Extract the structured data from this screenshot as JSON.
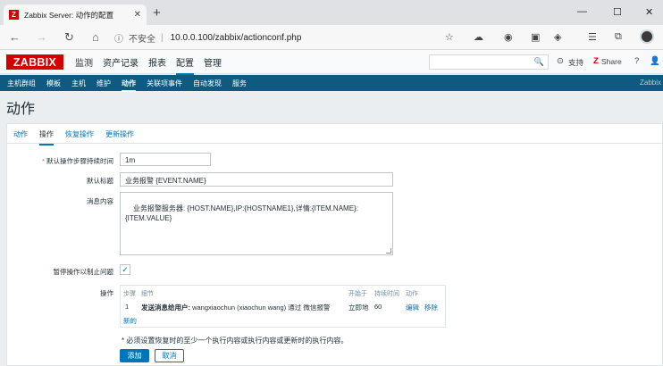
{
  "browser": {
    "tab_title": "Zabbix Server: 动作的配置",
    "tab_close": "✕",
    "new_tab": "+",
    "win_min": "—",
    "win_max": "☐",
    "win_close": "✕",
    "insecure_label": "不安全",
    "url": "10.0.0.100/zabbix/actionconf.php"
  },
  "zabbix": {
    "logo": "ZABBIX",
    "top_menu": [
      "监测",
      "资产记录",
      "报表",
      "配置",
      "管理"
    ],
    "active_top_menu": "配置",
    "support_label": "支持",
    "share_label": "Share",
    "help_icon": "?",
    "user_icon": "👤",
    "power_icon": "⏻",
    "sub_menu": [
      "主机群组",
      "模板",
      "主机",
      "维护",
      "动作",
      "关联项事件",
      "自动发现",
      "服务"
    ],
    "active_sub_menu": "动作",
    "server_name": "Zabbix",
    "page_title": "动作"
  },
  "form": {
    "tabs": [
      "动作",
      "操作",
      "恢复操作",
      "更新操作"
    ],
    "active_tab": "操作",
    "step_duration_label": "默认操作步骤持续时间",
    "required_marker": "*",
    "step_duration_value": "1m",
    "subject_label": "默认标题",
    "subject_value": "业务报警 {EVENT.NAME}",
    "message_label": "消息内容",
    "message_value": "业务报警服务器: {HOST.NAME},IP:{HOSTNAME1},详情:{ITEM.NAME}:\n{ITEM.VALUE}",
    "pause_label": "暂停操作以制止问题",
    "pause_checked": "✓",
    "operations_label": "操作",
    "ops_headers": [
      "步骤",
      "细节",
      "开始于",
      "持续时间",
      "动作"
    ],
    "ops_rows": [
      {
        "step": "1",
        "detail_bold": "发送消息给用户:",
        "detail_rest": " wangxiaochun (xiaochun wang) 通过 微信报警",
        "start": "立即地",
        "duration": "60",
        "edit": "编辑",
        "remove": "移除"
      }
    ],
    "new_link": "新的",
    "note": "* 必须设置恢复时的至少一个执行内容或执行内容或更新时的执行内容。",
    "add_button": "添加",
    "cancel_button": "取消"
  }
}
